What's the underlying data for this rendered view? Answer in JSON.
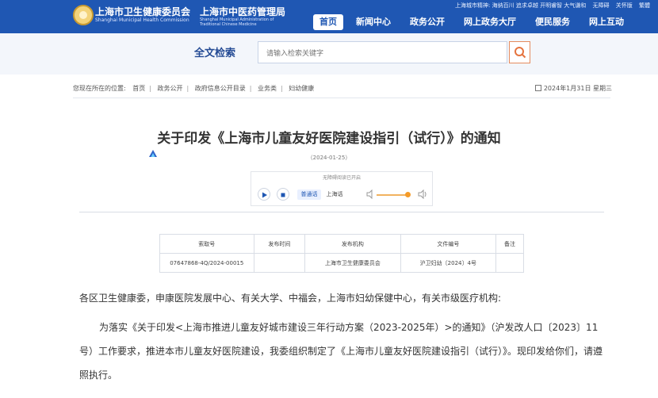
{
  "header": {
    "org1_name": "上海市卫生健康委员会",
    "org1_en": "Shanghai Municipal Health Commission",
    "org2_name": "上海市中医药管理局",
    "org2_en": "Shanghai Municipal Administration of Traditional Chinese Medicine",
    "top_links": [
      "上海城市精神: 海纳百川 追求卓越 开明睿智 大气谦和",
      "无障碍",
      "关怀版",
      "繁體"
    ],
    "nav": [
      "首页",
      "新闻中心",
      "政务公开",
      "网上政务大厅",
      "便民服务",
      "网上互动"
    ]
  },
  "search": {
    "title": "全文检索",
    "placeholder": "请输入检索关键字"
  },
  "breadcrumb": {
    "label": "您现在所在的位置:",
    "items": [
      "首页",
      "政务公开",
      "政府信息公开目录",
      "业务类",
      "妇幼健康"
    ]
  },
  "date_today": "2024年1月31日 星期三",
  "article": {
    "title": "关于印发《上海市儿童友好医院建设指引（试行）》的通知",
    "pubdate": "（2024-01-25）",
    "audio": {
      "label": "无障碍阅读已开启",
      "mandarin": "普通话",
      "shanghai": "上海话",
      "volume": 0.75
    },
    "meta_headers": [
      "索取号",
      "发布时间",
      "发布机构",
      "文件编号",
      "备注"
    ],
    "meta_values": [
      "07647868-4Q/2024-00015",
      "",
      "上海市卫生健康委员会",
      "沪卫妇幼〔2024〕4号",
      ""
    ],
    "p1": "各区卫生健康委，申康医院发展中心、有关大学、中福会，上海市妇幼保健中心，有关市级医疗机构:",
    "p2": "为落实《关于印发<上海市推进儿童友好城市建设三年行动方案（2023-2025年）>的通知》（沪发改人口〔2023〕11号）工作要求，推进本市儿童友好医院建设，我委组织制定了《上海市儿童友好医院建设指引（试行）》。现印发给你们，请遵照执行。"
  }
}
